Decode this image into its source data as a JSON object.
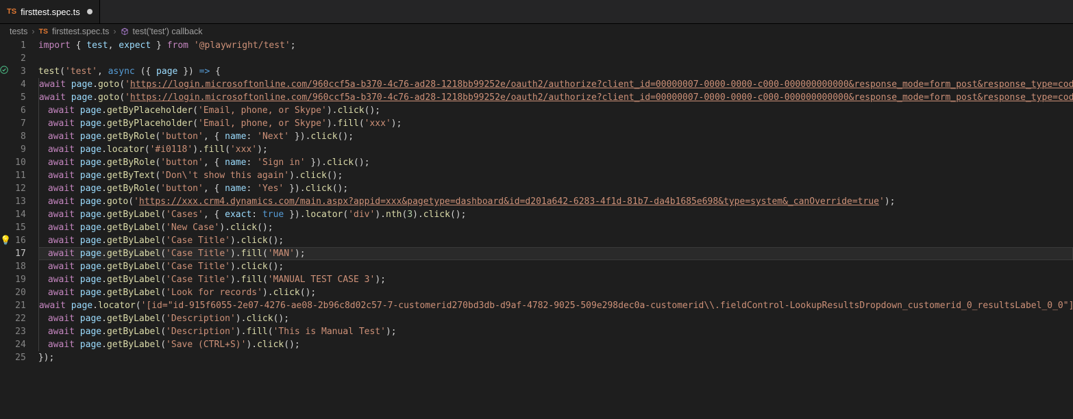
{
  "tab": {
    "badge": "TS",
    "filename": "firsttest.spec.ts",
    "dirty": true
  },
  "breadcrumbs": {
    "folder": "tests",
    "file_badge": "TS",
    "file": "firsttest.spec.ts",
    "symbol": "test('test') callback"
  },
  "active_line": 17,
  "gutter_marks": {
    "3": "pass",
    "16": "bulb"
  },
  "code": [
    [
      [
        "import",
        "keyword"
      ],
      [
        " ",
        "punct"
      ],
      [
        "{",
        "punct"
      ],
      [
        " ",
        "punct"
      ],
      [
        "test",
        "ident"
      ],
      [
        ",",
        "punct"
      ],
      [
        " ",
        "punct"
      ],
      [
        "expect",
        "ident"
      ],
      [
        " ",
        "punct"
      ],
      [
        "}",
        "punct"
      ],
      [
        " ",
        "punct"
      ],
      [
        "from",
        "keyword"
      ],
      [
        " ",
        "punct"
      ],
      [
        "'@playwright/test'",
        "string"
      ],
      [
        ";",
        "punct"
      ]
    ],
    [],
    [
      [
        "test",
        "func"
      ],
      [
        "(",
        "punct"
      ],
      [
        "'test'",
        "string"
      ],
      [
        ",",
        "punct"
      ],
      [
        " ",
        "punct"
      ],
      [
        "async",
        "control"
      ],
      [
        " ",
        "punct"
      ],
      [
        "(",
        "punct"
      ],
      [
        "{",
        "punct"
      ],
      [
        " ",
        "punct"
      ],
      [
        "page",
        "ident"
      ],
      [
        " ",
        "punct"
      ],
      [
        "}",
        "punct"
      ],
      [
        ")",
        "punct"
      ],
      [
        " ",
        "punct"
      ],
      [
        "=>",
        "control"
      ],
      [
        " ",
        "punct"
      ],
      [
        "{",
        "punct"
      ]
    ],
    [
      [
        "  ",
        "indent"
      ],
      [
        "await",
        "keyword"
      ],
      [
        " ",
        "punct"
      ],
      [
        "page",
        "ident"
      ],
      [
        ".",
        "punct"
      ],
      [
        "goto",
        "func"
      ],
      [
        "(",
        "punct"
      ],
      [
        "'",
        "string"
      ],
      [
        "https://login.microsoftonline.com/960ccf5a-b370-4c76-ad28-1218bb99252e/oauth2/authorize?client_id=00000007-0000-0000-c000-000000000000&response_mode=form_post&response_type=cod",
        "link"
      ]
    ],
    [
      [
        "  ",
        "indent"
      ],
      [
        "await",
        "keyword"
      ],
      [
        " ",
        "punct"
      ],
      [
        "page",
        "ident"
      ],
      [
        ".",
        "punct"
      ],
      [
        "goto",
        "func"
      ],
      [
        "(",
        "punct"
      ],
      [
        "'",
        "string"
      ],
      [
        "https://login.microsoftonline.com/960ccf5a-b370-4c76-ad28-1218bb99252e/oauth2/authorize?client_id=00000007-0000-0000-c000-000000000000&response_mode=form_post&response_type=cod",
        "link"
      ]
    ],
    [
      [
        "  ",
        "indent"
      ],
      [
        "await",
        "keyword"
      ],
      [
        " ",
        "punct"
      ],
      [
        "page",
        "ident"
      ],
      [
        ".",
        "punct"
      ],
      [
        "getByPlaceholder",
        "func"
      ],
      [
        "(",
        "punct"
      ],
      [
        "'Email, phone, or Skype'",
        "string"
      ],
      [
        ")",
        "punct"
      ],
      [
        ".",
        "punct"
      ],
      [
        "click",
        "func"
      ],
      [
        "(",
        "punct"
      ],
      [
        ")",
        "punct"
      ],
      [
        ";",
        "punct"
      ]
    ],
    [
      [
        "  ",
        "indent"
      ],
      [
        "await",
        "keyword"
      ],
      [
        " ",
        "punct"
      ],
      [
        "page",
        "ident"
      ],
      [
        ".",
        "punct"
      ],
      [
        "getByPlaceholder",
        "func"
      ],
      [
        "(",
        "punct"
      ],
      [
        "'Email, phone, or Skype'",
        "string"
      ],
      [
        ")",
        "punct"
      ],
      [
        ".",
        "punct"
      ],
      [
        "fill",
        "func"
      ],
      [
        "(",
        "punct"
      ],
      [
        "'xxx'",
        "string"
      ],
      [
        ")",
        "punct"
      ],
      [
        ";",
        "punct"
      ]
    ],
    [
      [
        "  ",
        "indent"
      ],
      [
        "await",
        "keyword"
      ],
      [
        " ",
        "punct"
      ],
      [
        "page",
        "ident"
      ],
      [
        ".",
        "punct"
      ],
      [
        "getByRole",
        "func"
      ],
      [
        "(",
        "punct"
      ],
      [
        "'button'",
        "string"
      ],
      [
        ",",
        "punct"
      ],
      [
        " ",
        "punct"
      ],
      [
        "{",
        "punct"
      ],
      [
        " ",
        "punct"
      ],
      [
        "name",
        "ident"
      ],
      [
        ":",
        "punct"
      ],
      [
        " ",
        "punct"
      ],
      [
        "'Next'",
        "string"
      ],
      [
        " ",
        "punct"
      ],
      [
        "}",
        "punct"
      ],
      [
        ")",
        "punct"
      ],
      [
        ".",
        "punct"
      ],
      [
        "click",
        "func"
      ],
      [
        "(",
        "punct"
      ],
      [
        ")",
        "punct"
      ],
      [
        ";",
        "punct"
      ]
    ],
    [
      [
        "  ",
        "indent"
      ],
      [
        "await",
        "keyword"
      ],
      [
        " ",
        "punct"
      ],
      [
        "page",
        "ident"
      ],
      [
        ".",
        "punct"
      ],
      [
        "locator",
        "func"
      ],
      [
        "(",
        "punct"
      ],
      [
        "'#i0118'",
        "string"
      ],
      [
        ")",
        "punct"
      ],
      [
        ".",
        "punct"
      ],
      [
        "fill",
        "func"
      ],
      [
        "(",
        "punct"
      ],
      [
        "'xxx'",
        "string"
      ],
      [
        ")",
        "punct"
      ],
      [
        ";",
        "punct"
      ]
    ],
    [
      [
        "  ",
        "indent"
      ],
      [
        "await",
        "keyword"
      ],
      [
        " ",
        "punct"
      ],
      [
        "page",
        "ident"
      ],
      [
        ".",
        "punct"
      ],
      [
        "getByRole",
        "func"
      ],
      [
        "(",
        "punct"
      ],
      [
        "'button'",
        "string"
      ],
      [
        ",",
        "punct"
      ],
      [
        " ",
        "punct"
      ],
      [
        "{",
        "punct"
      ],
      [
        " ",
        "punct"
      ],
      [
        "name",
        "ident"
      ],
      [
        ":",
        "punct"
      ],
      [
        " ",
        "punct"
      ],
      [
        "'Sign in'",
        "string"
      ],
      [
        " ",
        "punct"
      ],
      [
        "}",
        "punct"
      ],
      [
        ")",
        "punct"
      ],
      [
        ".",
        "punct"
      ],
      [
        "click",
        "func"
      ],
      [
        "(",
        "punct"
      ],
      [
        ")",
        "punct"
      ],
      [
        ";",
        "punct"
      ]
    ],
    [
      [
        "  ",
        "indent"
      ],
      [
        "await",
        "keyword"
      ],
      [
        " ",
        "punct"
      ],
      [
        "page",
        "ident"
      ],
      [
        ".",
        "punct"
      ],
      [
        "getByText",
        "func"
      ],
      [
        "(",
        "punct"
      ],
      [
        "'Don",
        "string"
      ],
      [
        "\\'",
        "string"
      ],
      [
        "t show this again'",
        "string"
      ],
      [
        ")",
        "punct"
      ],
      [
        ".",
        "punct"
      ],
      [
        "click",
        "func"
      ],
      [
        "(",
        "punct"
      ],
      [
        ")",
        "punct"
      ],
      [
        ";",
        "punct"
      ]
    ],
    [
      [
        "  ",
        "indent"
      ],
      [
        "await",
        "keyword"
      ],
      [
        " ",
        "punct"
      ],
      [
        "page",
        "ident"
      ],
      [
        ".",
        "punct"
      ],
      [
        "getByRole",
        "func"
      ],
      [
        "(",
        "punct"
      ],
      [
        "'button'",
        "string"
      ],
      [
        ",",
        "punct"
      ],
      [
        " ",
        "punct"
      ],
      [
        "{",
        "punct"
      ],
      [
        " ",
        "punct"
      ],
      [
        "name",
        "ident"
      ],
      [
        ":",
        "punct"
      ],
      [
        " ",
        "punct"
      ],
      [
        "'Yes'",
        "string"
      ],
      [
        " ",
        "punct"
      ],
      [
        "}",
        "punct"
      ],
      [
        ")",
        "punct"
      ],
      [
        ".",
        "punct"
      ],
      [
        "click",
        "func"
      ],
      [
        "(",
        "punct"
      ],
      [
        ")",
        "punct"
      ],
      [
        ";",
        "punct"
      ]
    ],
    [
      [
        "  ",
        "indent"
      ],
      [
        "await",
        "keyword"
      ],
      [
        " ",
        "punct"
      ],
      [
        "page",
        "ident"
      ],
      [
        ".",
        "punct"
      ],
      [
        "goto",
        "func"
      ],
      [
        "(",
        "punct"
      ],
      [
        "'",
        "string"
      ],
      [
        "https://xxx.crm4.dynamics.com/main.aspx?appid=xxx&pagetype=dashboard&id=d201a642-6283-4f1d-81b7-da4b1685e698&type=system&_canOverride=true",
        "link"
      ],
      [
        "'",
        "string"
      ],
      [
        ")",
        "punct"
      ],
      [
        ";",
        "punct"
      ]
    ],
    [
      [
        "  ",
        "indent"
      ],
      [
        "await",
        "keyword"
      ],
      [
        " ",
        "punct"
      ],
      [
        "page",
        "ident"
      ],
      [
        ".",
        "punct"
      ],
      [
        "getByLabel",
        "func"
      ],
      [
        "(",
        "punct"
      ],
      [
        "'Cases'",
        "string"
      ],
      [
        ",",
        "punct"
      ],
      [
        " ",
        "punct"
      ],
      [
        "{",
        "punct"
      ],
      [
        " ",
        "punct"
      ],
      [
        "exact",
        "ident"
      ],
      [
        ":",
        "punct"
      ],
      [
        " ",
        "punct"
      ],
      [
        "true",
        "control"
      ],
      [
        " ",
        "punct"
      ],
      [
        "}",
        "punct"
      ],
      [
        ")",
        "punct"
      ],
      [
        ".",
        "punct"
      ],
      [
        "locator",
        "func"
      ],
      [
        "(",
        "punct"
      ],
      [
        "'div'",
        "string"
      ],
      [
        ")",
        "punct"
      ],
      [
        ".",
        "punct"
      ],
      [
        "nth",
        "func"
      ],
      [
        "(",
        "punct"
      ],
      [
        "3",
        "num"
      ],
      [
        ")",
        "punct"
      ],
      [
        ".",
        "punct"
      ],
      [
        "click",
        "func"
      ],
      [
        "(",
        "punct"
      ],
      [
        ")",
        "punct"
      ],
      [
        ";",
        "punct"
      ]
    ],
    [
      [
        "  ",
        "indent"
      ],
      [
        "await",
        "keyword"
      ],
      [
        " ",
        "punct"
      ],
      [
        "page",
        "ident"
      ],
      [
        ".",
        "punct"
      ],
      [
        "getByLabel",
        "func"
      ],
      [
        "(",
        "punct"
      ],
      [
        "'New Case'",
        "string"
      ],
      [
        ")",
        "punct"
      ],
      [
        ".",
        "punct"
      ],
      [
        "click",
        "func"
      ],
      [
        "(",
        "punct"
      ],
      [
        ")",
        "punct"
      ],
      [
        ";",
        "punct"
      ]
    ],
    [
      [
        "  ",
        "indent"
      ],
      [
        "await",
        "keyword"
      ],
      [
        " ",
        "punct"
      ],
      [
        "page",
        "ident"
      ],
      [
        ".",
        "punct"
      ],
      [
        "getByLabel",
        "func"
      ],
      [
        "(",
        "punct"
      ],
      [
        "'Case Title'",
        "string"
      ],
      [
        ")",
        "punct"
      ],
      [
        ".",
        "punct"
      ],
      [
        "click",
        "func"
      ],
      [
        "(",
        "punct"
      ],
      [
        ")",
        "punct"
      ],
      [
        ";",
        "punct"
      ]
    ],
    [
      [
        "  ",
        "indent"
      ],
      [
        "await",
        "keyword"
      ],
      [
        " ",
        "punct"
      ],
      [
        "page",
        "ident"
      ],
      [
        ".",
        "punct"
      ],
      [
        "getByLabel",
        "func"
      ],
      [
        "(",
        "punct"
      ],
      [
        "'Case Title'",
        "string"
      ],
      [
        ")",
        "punct"
      ],
      [
        ".",
        "punct"
      ],
      [
        "fill",
        "func"
      ],
      [
        "(",
        "punct"
      ],
      [
        "'MAN'",
        "string"
      ],
      [
        ")",
        "punct"
      ],
      [
        ";",
        "punct"
      ]
    ],
    [
      [
        "  ",
        "indent"
      ],
      [
        "await",
        "keyword"
      ],
      [
        " ",
        "punct"
      ],
      [
        "page",
        "ident"
      ],
      [
        ".",
        "punct"
      ],
      [
        "getByLabel",
        "func"
      ],
      [
        "(",
        "punct"
      ],
      [
        "'Case Title'",
        "string"
      ],
      [
        ")",
        "punct"
      ],
      [
        ".",
        "punct"
      ],
      [
        "click",
        "func"
      ],
      [
        "(",
        "punct"
      ],
      [
        ")",
        "punct"
      ],
      [
        ";",
        "punct"
      ]
    ],
    [
      [
        "  ",
        "indent"
      ],
      [
        "await",
        "keyword"
      ],
      [
        " ",
        "punct"
      ],
      [
        "page",
        "ident"
      ],
      [
        ".",
        "punct"
      ],
      [
        "getByLabel",
        "func"
      ],
      [
        "(",
        "punct"
      ],
      [
        "'Case Title'",
        "string"
      ],
      [
        ")",
        "punct"
      ],
      [
        ".",
        "punct"
      ],
      [
        "fill",
        "func"
      ],
      [
        "(",
        "punct"
      ],
      [
        "'MANUAL TEST CASE 3'",
        "string"
      ],
      [
        ")",
        "punct"
      ],
      [
        ";",
        "punct"
      ]
    ],
    [
      [
        "  ",
        "indent"
      ],
      [
        "await",
        "keyword"
      ],
      [
        " ",
        "punct"
      ],
      [
        "page",
        "ident"
      ],
      [
        ".",
        "punct"
      ],
      [
        "getByLabel",
        "func"
      ],
      [
        "(",
        "punct"
      ],
      [
        "'Look for records'",
        "string"
      ],
      [
        ")",
        "punct"
      ],
      [
        ".",
        "punct"
      ],
      [
        "click",
        "func"
      ],
      [
        "(",
        "punct"
      ],
      [
        ")",
        "punct"
      ],
      [
        ";",
        "punct"
      ]
    ],
    [
      [
        "  ",
        "indent"
      ],
      [
        "await",
        "keyword"
      ],
      [
        " ",
        "punct"
      ],
      [
        "page",
        "ident"
      ],
      [
        ".",
        "punct"
      ],
      [
        "locator",
        "func"
      ],
      [
        "(",
        "punct"
      ],
      [
        "'[id=\"id-915f6055-2e07-4276-ae08-2b96c8d02c57-7-customerid270bd3db-d9af-4782-9025-509e298dec0a-customerid\\\\.fieldControl-LookupResultsDropdown_customerid_0_resultsLabel_0_0\"]",
        "string"
      ]
    ],
    [
      [
        "  ",
        "indent"
      ],
      [
        "await",
        "keyword"
      ],
      [
        " ",
        "punct"
      ],
      [
        "page",
        "ident"
      ],
      [
        ".",
        "punct"
      ],
      [
        "getByLabel",
        "func"
      ],
      [
        "(",
        "punct"
      ],
      [
        "'Description'",
        "string"
      ],
      [
        ")",
        "punct"
      ],
      [
        ".",
        "punct"
      ],
      [
        "click",
        "func"
      ],
      [
        "(",
        "punct"
      ],
      [
        ")",
        "punct"
      ],
      [
        ";",
        "punct"
      ]
    ],
    [
      [
        "  ",
        "indent"
      ],
      [
        "await",
        "keyword"
      ],
      [
        " ",
        "punct"
      ],
      [
        "page",
        "ident"
      ],
      [
        ".",
        "punct"
      ],
      [
        "getByLabel",
        "func"
      ],
      [
        "(",
        "punct"
      ],
      [
        "'Description'",
        "string"
      ],
      [
        ")",
        "punct"
      ],
      [
        ".",
        "punct"
      ],
      [
        "fill",
        "func"
      ],
      [
        "(",
        "punct"
      ],
      [
        "'This is Manual Test'",
        "string"
      ],
      [
        ")",
        "punct"
      ],
      [
        ";",
        "punct"
      ]
    ],
    [
      [
        "  ",
        "indent"
      ],
      [
        "await",
        "keyword"
      ],
      [
        " ",
        "punct"
      ],
      [
        "page",
        "ident"
      ],
      [
        ".",
        "punct"
      ],
      [
        "getByLabel",
        "func"
      ],
      [
        "(",
        "punct"
      ],
      [
        "'Save (CTRL+S)'",
        "string"
      ],
      [
        ")",
        "punct"
      ],
      [
        ".",
        "punct"
      ],
      [
        "click",
        "func"
      ],
      [
        "(",
        "punct"
      ],
      [
        ")",
        "punct"
      ],
      [
        ";",
        "punct"
      ]
    ],
    [
      [
        "}",
        "punct"
      ],
      [
        ")",
        "punct"
      ],
      [
        ";",
        "punct"
      ]
    ]
  ]
}
